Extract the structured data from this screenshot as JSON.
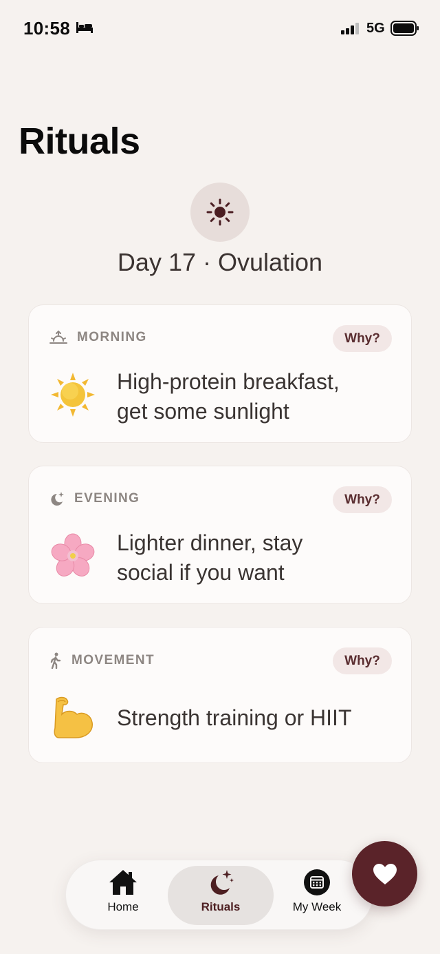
{
  "status_bar": {
    "time": "10:58",
    "network": "5G"
  },
  "page": {
    "title": "Rituals"
  },
  "phase": {
    "title": "Day 17 · Ovulation",
    "icon": "sun-icon"
  },
  "rituals": [
    {
      "label": "MORNING",
      "why": "Why?",
      "text_line1": "High-protein breakfast,",
      "text_line2": "get some sunlight",
      "emoji": "sun"
    },
    {
      "label": "EVENING",
      "why": "Why?",
      "text_line1": "Lighter dinner, stay",
      "text_line2": "social if you want",
      "emoji": "cherry-blossom"
    },
    {
      "label": "MOVEMENT",
      "why": "Why?",
      "text_line1": "Strength training or HIIT",
      "text_line2": "",
      "emoji": "flexed-biceps"
    }
  ],
  "tabs": [
    {
      "label": "Home",
      "icon": "house-icon",
      "active": false
    },
    {
      "label": "Rituals",
      "icon": "moon-stars-icon",
      "active": true
    },
    {
      "label": "My Week",
      "icon": "calendar-icon",
      "active": false
    }
  ],
  "fab": {
    "icon": "heart-icon"
  },
  "colors": {
    "accent": "#5a2329",
    "background": "#f6f2ef",
    "why_bg": "#f2e7e6"
  }
}
